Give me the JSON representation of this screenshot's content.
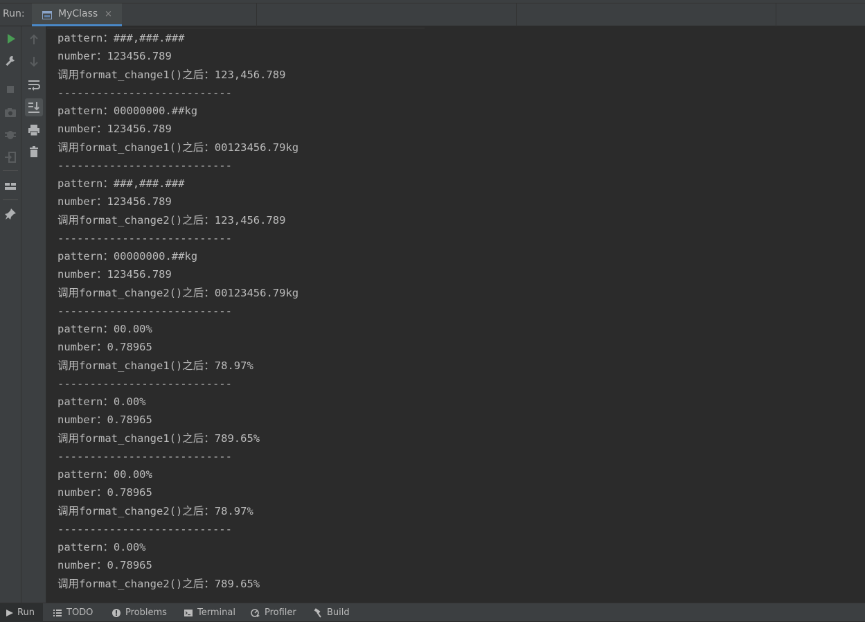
{
  "run_bar": {
    "label": "Run:",
    "tab": {
      "title": "MyClass",
      "close": "×"
    }
  },
  "console": {
    "lines": [
      "pattern：###,###.###",
      "number：123456.789",
      "调用format_change1()之后：123,456.789",
      "---------------------------",
      "pattern：00000000.##kg",
      "number：123456.789",
      "调用format_change1()之后：00123456.79kg",
      "---------------------------",
      "pattern：###,###.###",
      "number：123456.789",
      "调用format_change2()之后：123,456.789",
      "---------------------------",
      "pattern：00000000.##kg",
      "number：123456.789",
      "调用format_change2()之后：00123456.79kg",
      "---------------------------",
      "pattern：00.00%",
      "number：0.78965",
      "调用format_change1()之后：78.97%",
      "---------------------------",
      "pattern：0.00%",
      "number：0.78965",
      "调用format_change1()之后：789.65%",
      "---------------------------",
      "pattern：00.00%",
      "number：0.78965",
      "调用format_change2()之后：78.97%",
      "---------------------------",
      "pattern：0.00%",
      "number：0.78965",
      "调用format_change2()之后：789.65%"
    ]
  },
  "status_bar": {
    "items": [
      {
        "label": "Run",
        "icon": "play-icon"
      },
      {
        "label": "TODO",
        "icon": "list-icon"
      },
      {
        "label": "Problems",
        "icon": "info-icon"
      },
      {
        "label": "Terminal",
        "icon": "terminal-icon"
      },
      {
        "label": "Profiler",
        "icon": "profiler-icon"
      },
      {
        "label": "Build",
        "icon": "hammer-icon"
      }
    ]
  },
  "colors": {
    "accent": "#4a88c7",
    "run_green": "#499c54",
    "panel": "#3c3f41",
    "console_bg": "#2b2b2b",
    "text": "#bbbbbb"
  }
}
